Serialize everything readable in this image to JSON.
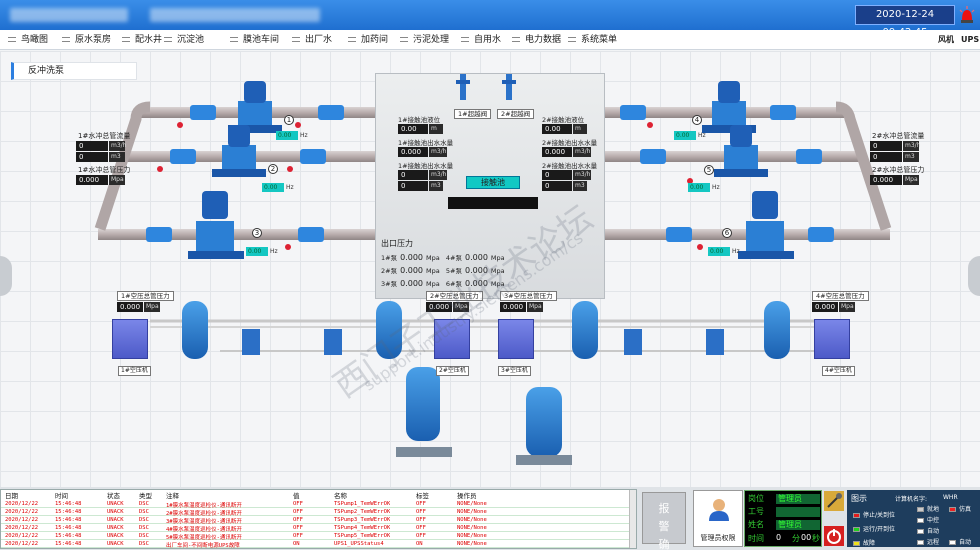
{
  "header": {
    "datetime": "2020-12-24  09:42:45"
  },
  "menu": {
    "items": [
      "鸟瞰图",
      "原水泵房",
      "配水井",
      "沉淀池",
      "膜池车间",
      "出厂水",
      "加药间",
      "污泥处理",
      "自用水",
      "电力数据",
      "系统菜单"
    ],
    "right": [
      "风机",
      "UPS"
    ]
  },
  "page": {
    "title": "反冲洗泵"
  },
  "left_panel": {
    "flow_label": "1#水冲总管流量",
    "flow_value": "0",
    "flow_unit": "m3/h",
    "flow_total": "0",
    "flow_total_unit": "m3",
    "pressure_label": "1#水冲总管压力",
    "pressure_value": "0.000",
    "pressure_unit": "Mpa"
  },
  "right_panel": {
    "flow_label": "2#水冲总管流量",
    "flow_value": "0",
    "flow_unit": "m3/h",
    "flow_total": "0",
    "flow_total_unit": "m3",
    "pressure_label": "2#水冲总管压力",
    "pressure_value": "0.000",
    "pressure_unit": "Mpa"
  },
  "pumps": [
    {
      "num": "1",
      "hz": "0.00",
      "unit": "Hz"
    },
    {
      "num": "2",
      "hz": "0.00",
      "unit": "Hz"
    },
    {
      "num": "3",
      "hz": "0.00",
      "unit": "Hz"
    },
    {
      "num": "4",
      "hz": "0.00",
      "unit": "Hz"
    },
    {
      "num": "5",
      "hz": "0.00",
      "unit": "Hz"
    },
    {
      "num": "6",
      "hz": "0.00",
      "unit": "Hz"
    }
  ],
  "tank": {
    "valve1": "1#超越阀",
    "valve2": "2#超越阀",
    "l1_label": "1#接触池液位",
    "l1_value": "0.00",
    "l1_unit": "m",
    "l2_label": "2#接触池液位",
    "l2_value": "0.00",
    "l2_unit": "m",
    "f1_label": "1#接触池出水水量",
    "f1_value": "0.000",
    "f1_unit": "m3/h",
    "f2_label": "2#接触池出水水量",
    "f2_value": "0.000",
    "f2_unit": "m3/h",
    "t1_label": "1#接触池出水水量",
    "t1_value": "0",
    "t1_unit": "m3",
    "t2_label": "2#接触池出水水量",
    "t2_value": "0",
    "t2_unit": "m3",
    "t1_rate": "0",
    "t1_rate_unit": "m3/h",
    "t2_rate": "0",
    "t2_rate_unit": "m3/h",
    "pool_button": "接触池",
    "outlet_title": "出口压力",
    "outlet_rows": [
      {
        "a": "1#泵",
        "av": "0.000",
        "au": "Mpa",
        "b": "4#泵",
        "bv": "0.000",
        "bu": "Mpa"
      },
      {
        "a": "2#泵",
        "av": "0.000",
        "au": "Mpa",
        "b": "5#泵",
        "bv": "0.000",
        "bu": "Mpa"
      },
      {
        "a": "3#泵",
        "av": "0.000",
        "au": "Mpa",
        "b": "6#泵",
        "bv": "0.000",
        "bu": "Mpa"
      }
    ]
  },
  "compressors": {
    "p1_label": "1#空压总管压力",
    "p1_value": "0.000",
    "p1_unit": "Mpa",
    "p2_label": "2#空压总管压力",
    "p2_value": "0.000",
    "p2_unit": "Mpa",
    "p3_label": "3#空压总管压力",
    "p3_value": "0.000",
    "p3_unit": "Mpa",
    "p4_label": "4#空压总管压力",
    "p4_value": "0.000",
    "p4_unit": "Mpa",
    "names": [
      "1#空压机",
      "2#空压机",
      "3#空压机",
      "4#空压机"
    ]
  },
  "watermark": {
    "text1": "西门子工业技术论坛",
    "text2": "support.industry.siemens.com/cs"
  },
  "log": {
    "headers": [
      "日期",
      "时间",
      "状态",
      "类型",
      "注释",
      "值",
      "名称",
      "标签",
      "操作员"
    ],
    "rows": [
      [
        "2020/12/22",
        "15:46:48",
        "UNACK",
        "DSC",
        "1#膜水泵温度巡检仪-通讯断开",
        "OFF",
        "TSPump1_TemWErrOK",
        "OFF",
        "NONE/None"
      ],
      [
        "2020/12/22",
        "15:46:48",
        "UNACK",
        "DSC",
        "2#膜水泵温度巡检仪-通讯断开",
        "OFF",
        "TSPump2_TemWErrOK",
        "OFF",
        "NONE/None"
      ],
      [
        "2020/12/22",
        "15:46:48",
        "UNACK",
        "DSC",
        "3#膜水泵温度巡检仪-通讯断开",
        "OFF",
        "TSPump3_TemWErrOK",
        "OFF",
        "NONE/None"
      ],
      [
        "2020/12/22",
        "15:46:48",
        "UNACK",
        "DSC",
        "4#膜水泵温度巡检仪-通讯断开",
        "OFF",
        "TSPump4_TemWErrOK",
        "OFF",
        "NONE/None"
      ],
      [
        "2020/12/22",
        "15:46:48",
        "UNACK",
        "DSC",
        "5#膜水泵温度巡检仪-通讯断开",
        "OFF",
        "TSPump5_TemWErrOK",
        "OFF",
        "NONE/None"
      ],
      [
        "2020/12/22",
        "15:46:48",
        "UNACK",
        "DSC",
        "出厂车间-不间断电源UPS故障",
        "ON",
        "UPS1_UPSStatus4",
        "ON",
        "NONE/None"
      ]
    ]
  },
  "ack_button": "报警确认",
  "admin": {
    "label": "管理员权限"
  },
  "info": {
    "post_label": "岗位",
    "post_value": "管理员",
    "id_label": "工号",
    "id_value": "",
    "name_label": "姓名",
    "name_value": "管理员",
    "time_label": "时间",
    "time_h": "0",
    "time_m_label": "分",
    "time_m": "00",
    "time_s_label": "秒"
  },
  "legend": {
    "title": "图示",
    "computer": "计算机名字:",
    "computer_name": "WHR",
    "items": [
      {
        "label": "停止/关到位",
        "color": "#e21b1b"
      },
      {
        "label": "运行/开到位",
        "color": "#1ed21e"
      },
      {
        "label": "故障",
        "color": "#f0e21b"
      },
      {
        "label": "就地",
        "color": "#cccccc"
      },
      {
        "label": "中控",
        "color": "#ffffff"
      },
      {
        "label": "自动",
        "color": "#ffffff"
      },
      {
        "label": "远程",
        "color": "#ffffff"
      },
      {
        "label": "仿真",
        "color": "#e22"
      },
      {
        "label": "自动",
        "color": "#fff"
      }
    ]
  }
}
